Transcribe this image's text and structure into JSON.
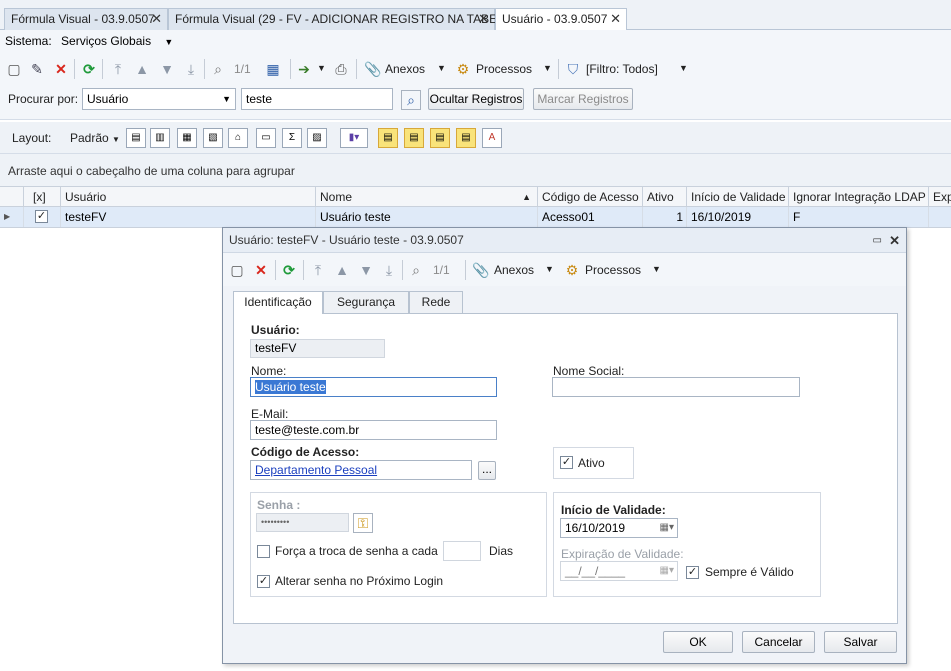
{
  "tabs": [
    {
      "label": "Fórmula Visual - 03.9.0507",
      "close": "✕"
    },
    {
      "label": "Fórmula Visual (29 - FV - ADICIONAR REGISTRO NA TABELA)",
      "close": "✕"
    },
    {
      "label": "Usuário - 03.9.0507",
      "close": "✕"
    }
  ],
  "system": {
    "label": "Sistema:",
    "value": "Serviços Globais"
  },
  "toolbar": {
    "record_counter": "1/1",
    "attachments": "Anexos",
    "processes": "Processos",
    "filter": "[Filtro: Todos]"
  },
  "search": {
    "label": "Procurar por:",
    "field": "Usuário",
    "value": "teste",
    "hide_button": "Ocultar Registros",
    "mark_button": "Marcar Registros"
  },
  "layout": {
    "label": "Layout:",
    "default": "Padrão"
  },
  "group_hint": "Arraste aqui o cabeçalho de uma coluna para agrupar",
  "grid": {
    "headers": [
      "[x]",
      "Usuário",
      "Nome",
      "Código de Acesso",
      "Ativo",
      "Início de Validade",
      "Ignorar Integração LDAP",
      "Exp"
    ],
    "rows": [
      {
        "checked": "✓",
        "usuario": "testeFV",
        "nome": "Usuário teste",
        "codigo": "Acesso01",
        "ativo": "1",
        "inicio": "16/10/2019",
        "ldap": "F"
      }
    ]
  },
  "dialog": {
    "title": "Usuário: testeFV - Usuário teste - 03.9.0507",
    "toolbar": {
      "record_counter": "1/1",
      "attachments": "Anexos",
      "processes": "Processos"
    },
    "tabs": [
      "Identificação",
      "Segurança",
      "Rede"
    ],
    "form": {
      "usuario_label": "Usuário:",
      "usuario_value": "testeFV",
      "nome_label": "Nome:",
      "nome_value": "Usuário teste",
      "nome_social_label": "Nome Social:",
      "nome_social_value": "",
      "email_label": "E-Mail:",
      "email_value": "teste@teste.com.br",
      "codigo_label": "Código de Acesso:",
      "codigo_value": "Departamento Pessoal",
      "browse": "...",
      "ativo_label": "Ativo",
      "senha_label": "Senha :",
      "senha_value": "•••••••••",
      "forca_label": "Força a troca de senha a cada",
      "dias_label": "Dias",
      "alterar_label": "Alterar senha no Próximo Login",
      "inicio_label": "Início de Validade:",
      "inicio_value": "16/10/2019",
      "expiracao_label": "Expiração de Validade:",
      "expiracao_value": "__/__/____",
      "sempre_label": "Sempre é Válido"
    },
    "buttons": {
      "ok": "OK",
      "cancel": "Cancelar",
      "save": "Salvar"
    }
  },
  "colors": {
    "accent": "#1a3fbf",
    "highlight": "#f9e37a",
    "selection": "#dfeaf8",
    "delete": "#d9261c",
    "refresh": "#1f9a3a"
  }
}
